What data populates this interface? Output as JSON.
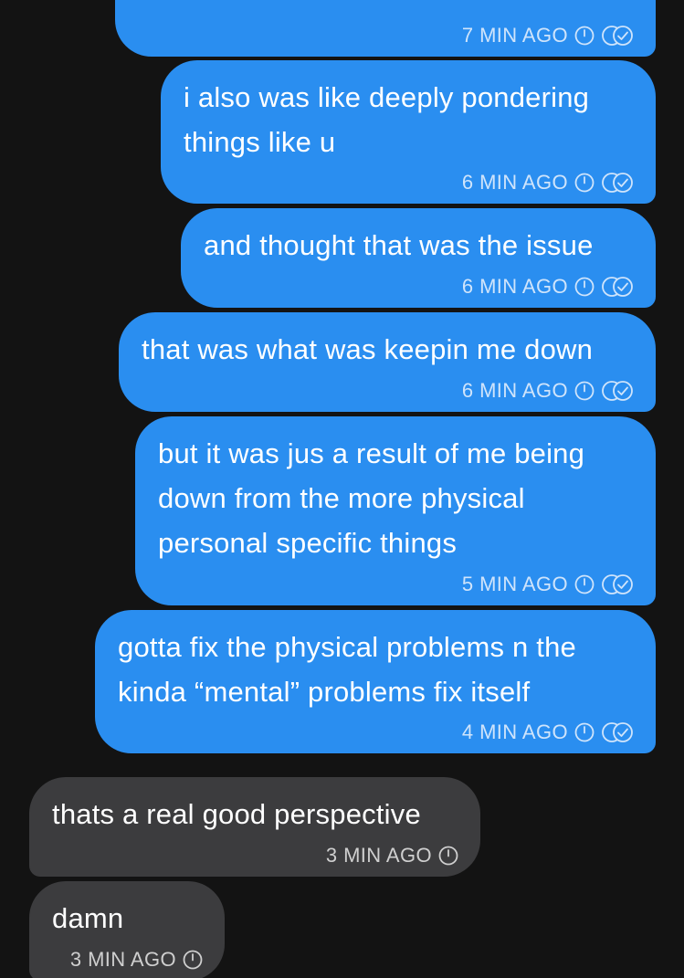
{
  "colors": {
    "background": "#131313",
    "outgoing_bubble": "#2a8ef0",
    "incoming_bubble": "#3c3c3e",
    "outgoing_meta": "#cfe4fb",
    "incoming_meta": "#cfcfcf"
  },
  "messages": [
    {
      "direction": "outgoing",
      "text": "",
      "time": "7 MIN AGO",
      "icons": [
        "timer-icon",
        "double-check-icon"
      ]
    },
    {
      "direction": "outgoing",
      "text": "i also was like deeply pondering\nthings like u",
      "time": "6 MIN AGO",
      "icons": [
        "timer-icon",
        "double-check-icon"
      ]
    },
    {
      "direction": "outgoing",
      "text": "and thought that was the issue",
      "time": "6 MIN AGO",
      "icons": [
        "timer-icon",
        "double-check-icon"
      ]
    },
    {
      "direction": "outgoing",
      "text": "that was what was keepin me down",
      "time": "6 MIN AGO",
      "icons": [
        "timer-icon",
        "double-check-icon"
      ]
    },
    {
      "direction": "outgoing",
      "text": "but it was jus a result of me being\ndown from the more physical\npersonal specific things",
      "time": "5 MIN AGO",
      "icons": [
        "timer-icon",
        "double-check-icon"
      ]
    },
    {
      "direction": "outgoing",
      "text": "gotta fix the physical problems n the\nkinda “mental” problems fix itself",
      "time": "4 MIN AGO",
      "icons": [
        "timer-icon",
        "double-check-icon"
      ]
    },
    {
      "direction": "incoming",
      "text": "thats a real good perspective",
      "time": "3 MIN AGO",
      "icons": [
        "timer-icon"
      ]
    },
    {
      "direction": "incoming",
      "text": "damn",
      "time": "3 MIN AGO",
      "icons": [
        "timer-icon"
      ]
    }
  ]
}
